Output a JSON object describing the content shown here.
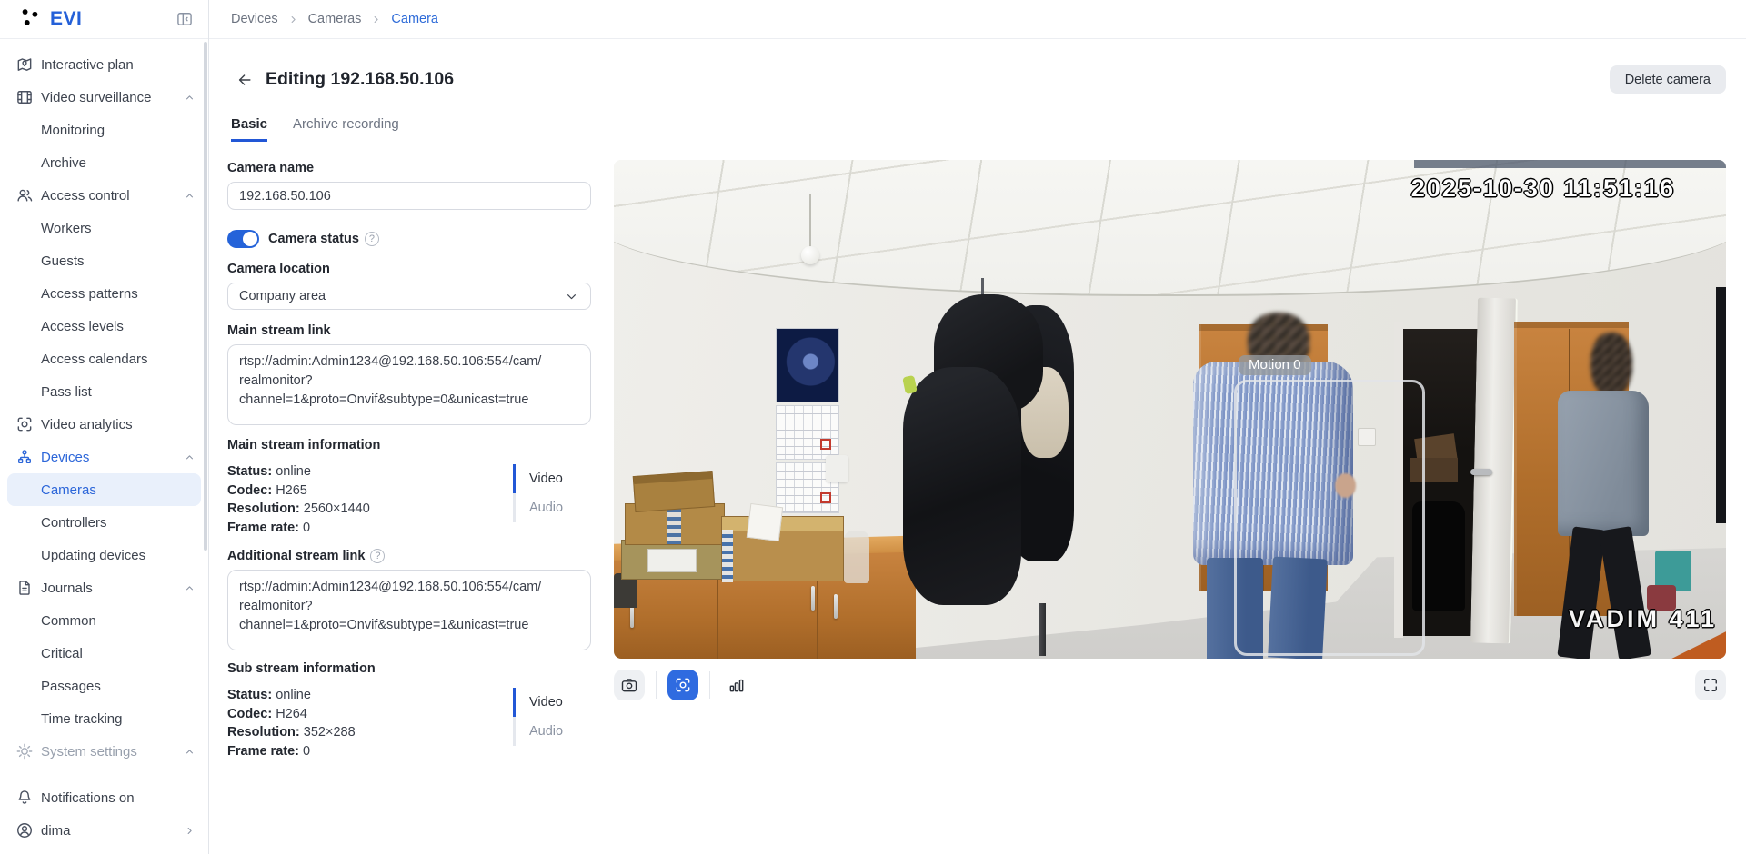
{
  "app": {
    "logo_text": "EVI"
  },
  "colors": {
    "accent": "#2460d8",
    "selected_bg": "#e9f0fb",
    "analytics_button": "#2f6be0"
  },
  "ui": {
    "help_glyph": "?"
  },
  "sidebar": {
    "items": [
      {
        "label": "Interactive plan"
      },
      {
        "label": "Video surveillance",
        "expanded": true
      },
      {
        "label": "Monitoring"
      },
      {
        "label": "Archive"
      },
      {
        "label": "Access control",
        "expanded": true
      },
      {
        "label": "Workers"
      },
      {
        "label": "Guests"
      },
      {
        "label": "Access patterns"
      },
      {
        "label": "Access levels"
      },
      {
        "label": "Access calendars"
      },
      {
        "label": "Pass list"
      },
      {
        "label": "Video analytics"
      },
      {
        "label": "Devices",
        "expanded": true,
        "active": true
      },
      {
        "label": "Cameras",
        "selected": true
      },
      {
        "label": "Controllers"
      },
      {
        "label": "Updating devices"
      },
      {
        "label": "Journals",
        "expanded": true
      },
      {
        "label": "Common"
      },
      {
        "label": "Critical"
      },
      {
        "label": "Passages"
      },
      {
        "label": "Time tracking"
      },
      {
        "label": "System settings",
        "expanded": true,
        "muted": true
      }
    ],
    "footer": {
      "notifications": "Notifications on",
      "user": "dima"
    }
  },
  "breadcrumb": {
    "items": [
      "Devices",
      "Cameras",
      "Camera"
    ]
  },
  "page": {
    "title": "Editing 192.168.50.106",
    "delete_button": "Delete camera"
  },
  "tabs": {
    "basic": "Basic",
    "archive": "Archive recording"
  },
  "form": {
    "camera_name": {
      "label": "Camera name",
      "value": "192.168.50.106"
    },
    "camera_status": {
      "label": "Camera status",
      "enabled": true
    },
    "camera_location": {
      "label": "Camera location",
      "value": "Company area"
    },
    "main_stream_link": {
      "label": "Main stream link",
      "value": "rtsp://admin:Admin1234@192.168.50.106:554/cam/\nrealmonitor?\nchannel=1&proto=Onvif&subtype=0&unicast=true"
    },
    "main_stream_info": {
      "title": "Main stream information",
      "rows": [
        {
          "key": "Status:",
          "value": "online"
        },
        {
          "key": "Codec:",
          "value": "H265"
        },
        {
          "key": "Resolution:",
          "value": "2560×1440"
        },
        {
          "key": "Frame rate:",
          "value": "0"
        }
      ],
      "tabs": {
        "video": "Video",
        "audio": "Audio"
      }
    },
    "additional_stream_link": {
      "label": "Additional stream link",
      "value": "rtsp://admin:Admin1234@192.168.50.106:554/cam/\nrealmonitor?\nchannel=1&proto=Onvif&subtype=1&unicast=true"
    },
    "sub_stream_info": {
      "title": "Sub stream information",
      "rows": [
        {
          "key": "Status:",
          "value": "online"
        },
        {
          "key": "Codec:",
          "value": "H264"
        },
        {
          "key": "Resolution:",
          "value": "352×288"
        },
        {
          "key": "Frame rate:",
          "value": "0"
        }
      ],
      "tabs": {
        "video": "Video",
        "audio": "Audio"
      }
    }
  },
  "player": {
    "timestamp": "2025-10-30 11:51:16",
    "motion_label": "Motion 0",
    "camera_overlay": "VADIM 411"
  }
}
